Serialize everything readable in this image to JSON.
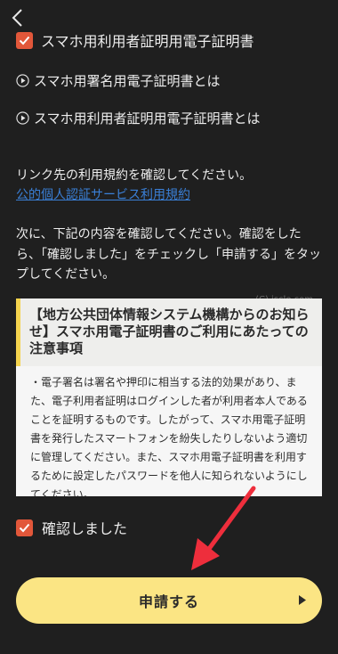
{
  "nav": {
    "back_icon": "chevron-left-icon"
  },
  "top_checkbox": {
    "label": "スマホ用利用者証明用電子証明書",
    "checked": true
  },
  "info_links": [
    {
      "label": "スマホ用署名用電子証明書とは",
      "icon": "play-circle-icon"
    },
    {
      "label": "スマホ用利用者証明用電子証明書とは",
      "icon": "play-circle-icon"
    }
  ],
  "terms": {
    "instruction": "リンク先の利用規約を確認してください。",
    "link_label": "公的個人認証サービス利用規約"
  },
  "confirm_instruction": "次に、下記の内容を確認してください。確認をしたら、「確認しました」をチェックし「申請する」をタップしてください。",
  "watermark": "(C) iscle.com",
  "notice": {
    "title": "【地方公共団体情報システム機構からのお知らせ】スマホ用電子証明書のご利用にあたっての注意事項",
    "body": "・電子署名は署名や押印に相当する法的効果があり、また、電子利用者証明はログインした者が利用者本人であることを証明するものです。したがって、スマホ用電子証明書を発行したスマートフォンを紛失したりしないよう適切に管理してください。また、スマホ用電子証明書を利用するために設定したパスワードを他人に知られないようにしてください。"
  },
  "confirm_checkbox": {
    "label": "確認しました",
    "checked": true
  },
  "apply_button": {
    "label": "申請する",
    "icon": "play-arrow-icon"
  },
  "colors": {
    "accent_checkbox": "#e2573a",
    "button_bg": "#fbe584",
    "link": "#3a7fd6",
    "annotation_arrow": "#ee2e3c"
  }
}
